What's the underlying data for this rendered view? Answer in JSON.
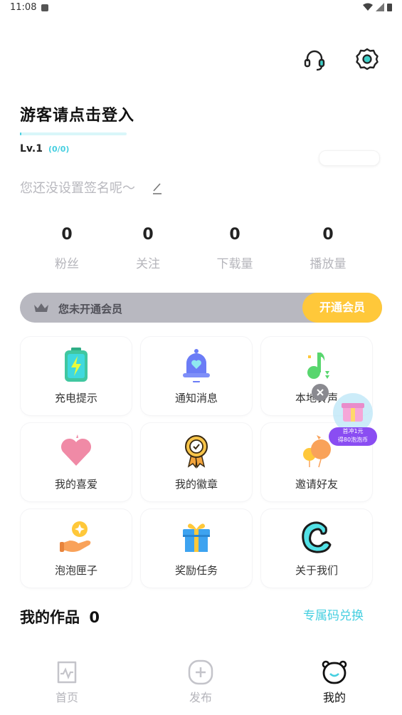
{
  "status_bar": {
    "time": "11:08"
  },
  "profile": {
    "name": "游客请点击登入",
    "level": "Lv.1",
    "level_progress": "(0/0)",
    "signature": "您还没设置签名呢～"
  },
  "stats": [
    {
      "value": "0",
      "label": "粉丝"
    },
    {
      "value": "0",
      "label": "关注"
    },
    {
      "value": "0",
      "label": "下载量"
    },
    {
      "value": "0",
      "label": "播放量"
    }
  ],
  "vip": {
    "status": "您未开通会员",
    "button": "开通会员"
  },
  "grid": [
    {
      "label": "充电提示",
      "icon": "battery-icon"
    },
    {
      "label": "通知消息",
      "icon": "bell-icon"
    },
    {
      "label": "本地铃声",
      "icon": "music-note-icon"
    },
    {
      "label": "我的喜爱",
      "icon": "heart-icon"
    },
    {
      "label": "我的徽章",
      "icon": "badge-medal-icon"
    },
    {
      "label": "邀请好友",
      "icon": "balloons-icon"
    },
    {
      "label": "泡泡匣子",
      "icon": "coin-hand-icon"
    },
    {
      "label": "奖励任务",
      "icon": "gift-icon"
    },
    {
      "label": "关于我们",
      "icon": "app-logo-icon"
    }
  ],
  "works": {
    "title": "我的作品",
    "count": "0",
    "exchange": "专属码兑换"
  },
  "promo": {
    "line1": "首冲1元",
    "line2": "得80泡泡币"
  },
  "tabs": [
    {
      "label": "首页",
      "icon": "home-pulse-icon",
      "active": false
    },
    {
      "label": "发布",
      "icon": "plus-circle-icon",
      "active": false
    },
    {
      "label": "我的",
      "icon": "bear-face-icon",
      "active": true
    }
  ],
  "colors": {
    "accent": "#46cfe0",
    "vip_button": "#ffc83a",
    "vip_bar": "#b8b8c0"
  }
}
